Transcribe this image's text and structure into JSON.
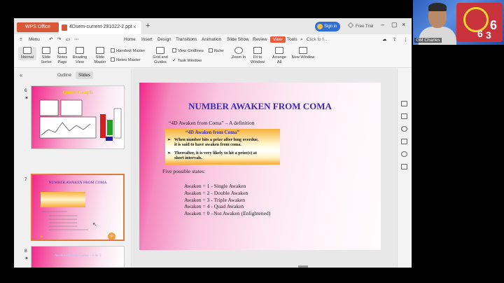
{
  "window": {
    "app_tab": "WPS Office",
    "doc_tab": "4Dsem-current-291022-2.ppt",
    "sign_in": "Sign in",
    "free_trial": "Free Trial"
  },
  "menu": {
    "menu_label": "Menu",
    "items": [
      "Home",
      "Insert",
      "Design",
      "Transitions",
      "Animation",
      "Slide Show",
      "Review",
      "View",
      "Tools"
    ],
    "active": "View",
    "search": "Click to f..."
  },
  "ribbon": {
    "normal": "Normal",
    "slide_sorter_1": "Slide",
    "slide_sorter_2": "Sorter",
    "notes_page_1": "Notes",
    "notes_page_2": "Page",
    "reading_view_1": "Reading",
    "reading_view_2": "View",
    "slide_master_1": "Slide",
    "slide_master_2": "Master",
    "handout_master": "Handout Master",
    "notes_master": "Notes Master",
    "grid_guides_1": "Grid and",
    "grid_guides_2": "Guides",
    "view_gridlines": "View Gridlines",
    "ruler": "Ruler",
    "task_window": "Task Window",
    "zoom_in": "Zoom In",
    "fit_window_1": "Fit to",
    "fit_window_2": "Window",
    "arrange_all_1": "Arrange",
    "arrange_all_2": "All",
    "new_window": "New Window"
  },
  "left_panel": {
    "outline_tab": "Outline",
    "slides_tab": "Slides",
    "slide_numbers": [
      "6",
      "7",
      "8"
    ],
    "thumb6_title": "Quick Graph",
    "thumb7_title": "NUMBER AWAKEN FROM COMA",
    "thumb8_title": "Awaken From Coma – 1 & 2"
  },
  "slide": {
    "title": "NUMBER AWAKEN FROM COMA",
    "definition": "“4D Awaken from Coma” – A definition",
    "box_header": "“4D Awaken from Coma”",
    "bullet1_line1": "When number hits a prize after long overdue,",
    "bullet1_line2": "it is said to have awaken from coma.",
    "bullet2_line1": "Thereafter, it is very likely to hit a prize(s) at",
    "bullet2_line2": "short intervals.",
    "five_states": "Five possible states:",
    "states": [
      "Awaken = 1 - Single Awaken",
      "Awaken = 2 - Double Awaken",
      "Awaken = 3 - Triple Awaken",
      "Awaken = 4 - Quad Awaken",
      "Awaken = 0 –Not Awaken (Enlightened)"
    ]
  },
  "webcam": {
    "participant": "GM Charles",
    "poster_digits": [
      "6",
      "6",
      "3"
    ]
  },
  "colors": {
    "accent": "#e85a3c",
    "slide_title": "#3b2ab8",
    "pink": "#f2268a",
    "box_orange": "#f7b23a"
  }
}
